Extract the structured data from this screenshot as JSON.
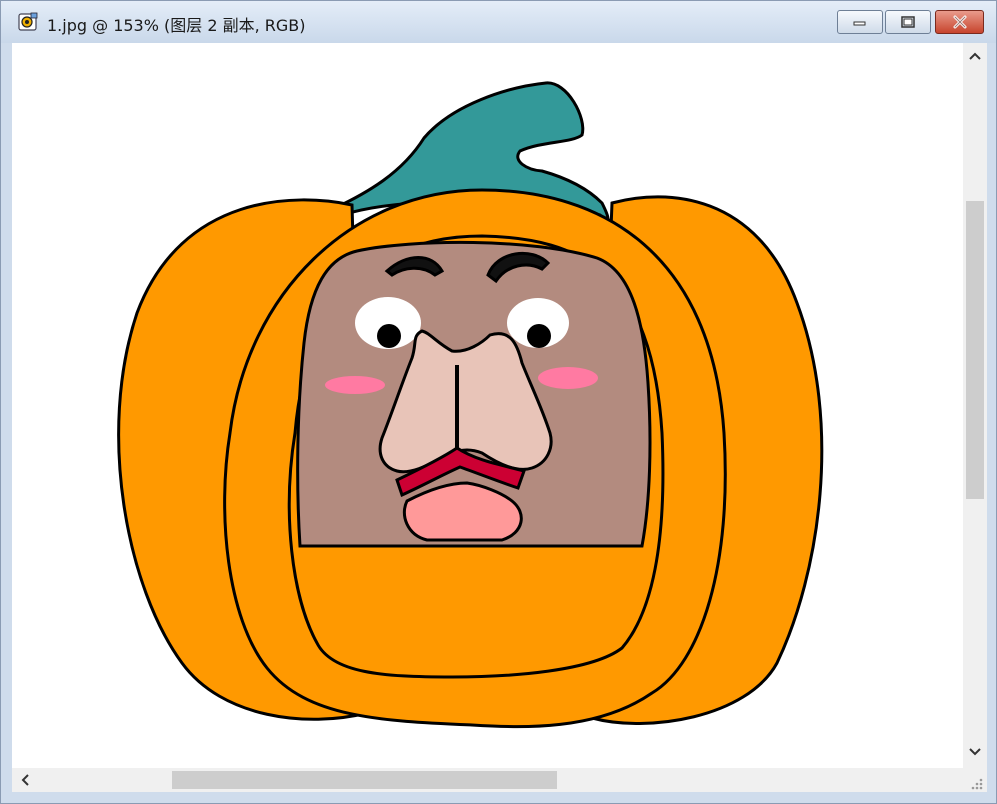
{
  "window": {
    "title": "1.jpg @ 153% (图层 2 副本, RGB)",
    "controls": {
      "minimize": "minimize-icon",
      "maximize": "maximize-icon",
      "close": "close-icon"
    }
  },
  "scrollbars": {
    "vertical_up": "chevron-up-icon",
    "vertical_down": "chevron-down-icon",
    "horizontal_left": "chevron-left-icon"
  },
  "colors": {
    "pumpkin": "#ff9900",
    "stem": "#339999",
    "face": "#b38b7f",
    "nose": "#e8c4b8",
    "cheek": "#ff7aa2",
    "lip": "#cc0033",
    "tongue": "#ff9999",
    "outline": "#000000"
  }
}
